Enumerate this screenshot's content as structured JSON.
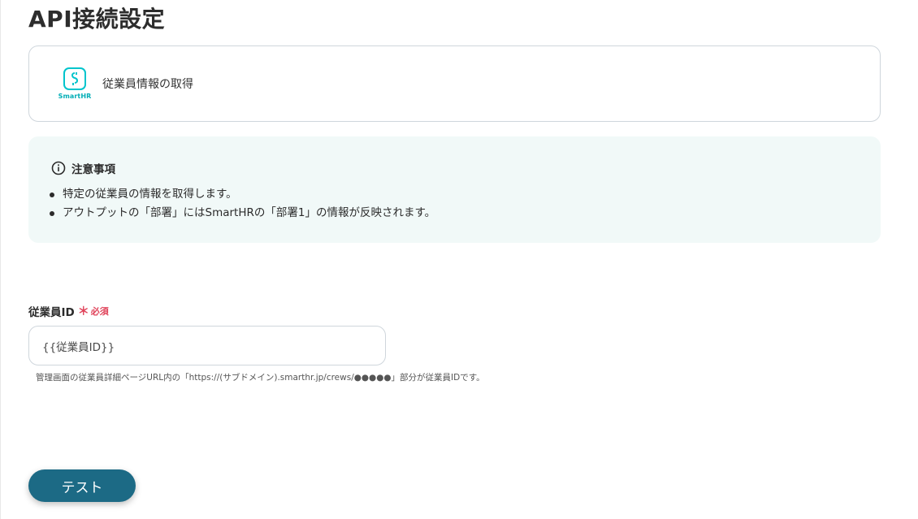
{
  "page": {
    "title": "API接続設定"
  },
  "app_card": {
    "logo_text": "SmartHR",
    "action_label": "従業員情報の取得"
  },
  "notice": {
    "heading": "注意事項",
    "items": [
      "特定の従業員の情報を取得します。",
      "アウトプットの「部署」にはSmartHRの「部署1」の情報が反映されます。"
    ]
  },
  "employee_id_field": {
    "label": "従業員ID",
    "required_mark": "＊",
    "required_text": "必須",
    "value": "{{従業員ID}}",
    "help": "管理画面の従業員詳細ページURL内の「https://(サブドメイン).smarthr.jp/crews/●●●●●」部分が従業員IDです。"
  },
  "test_button": {
    "label": "テスト"
  },
  "colors": {
    "brand": "#00c4cc",
    "button": "#1c6a85",
    "required": "#e0435a",
    "notice_bg": "#f1f9f8"
  }
}
